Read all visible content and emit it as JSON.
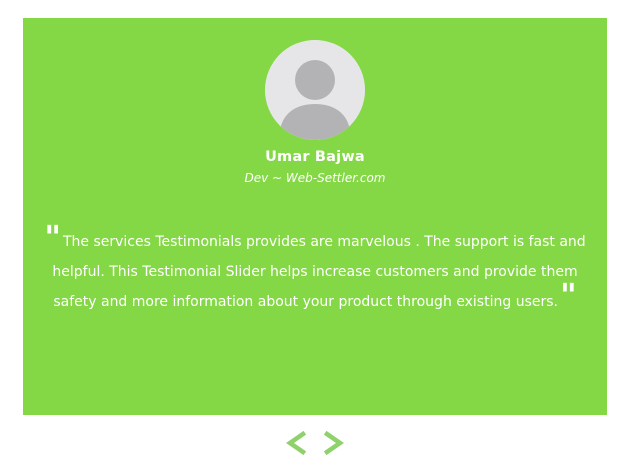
{
  "testimonial": {
    "name": "Umar Bajwa",
    "role": "Dev ~ Web-Settler.com",
    "open_quote": "\"",
    "close_quote": "\"",
    "text": "The services Testimonials provides are marvelous . The support is fast and helpful. This Testimonial Slider helps increase customers and provide them safety and more information about your product through existing users."
  },
  "nav": {
    "prev_icon": "chevron-left-icon",
    "next_icon": "chevron-right-icon"
  },
  "colors": {
    "card_background": "#84d846",
    "text": "#ffffff",
    "nav_arrows": "#8fd16a",
    "avatar_background": "#e6e6e8",
    "avatar_silhouette": "#b3b3b6"
  }
}
